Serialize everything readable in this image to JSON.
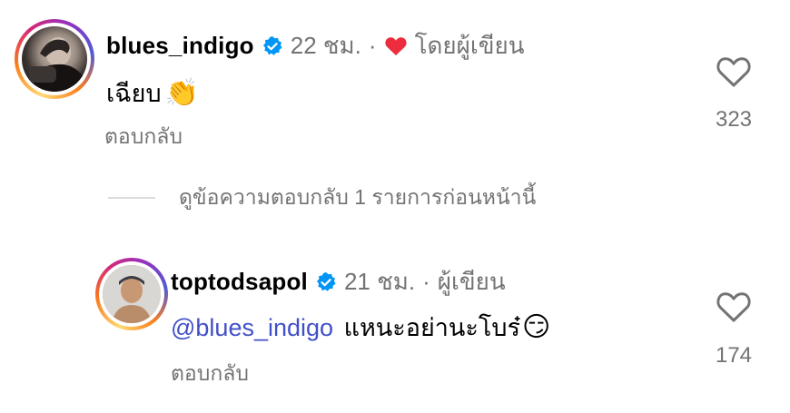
{
  "comments": [
    {
      "username": "blues_indigo",
      "time": "22 ชม.",
      "separator": "·",
      "liked_by_author": "โดยผู้เขียน",
      "text": "เฉียบ",
      "emoji": "👏",
      "reply_label": "ตอบกลับ",
      "like_count": "323",
      "icons": [
        "verified-badge-icon",
        "red-heart-icon",
        "heart-outline-icon"
      ]
    }
  ],
  "view_replies_label": "ดูข้อความตอบกลับ 1 รายการก่อนหน้านี้",
  "reply": {
    "username": "toptodsapol",
    "time": "21 ชม.",
    "separator": "·",
    "author_label": "ผู้เขียน",
    "mention": "@blues_indigo",
    "text": "แหนะอย่านะโบร๋",
    "emoji": "😏",
    "reply_label": "ตอบกลับ",
    "like_count": "174",
    "icons": [
      "verified-badge-icon",
      "heart-outline-icon"
    ]
  },
  "colors": {
    "verified_blue": "#0095f6",
    "liked_red": "#ed2d3d",
    "secondary_text": "#737373",
    "mention_blue": "#4150c8"
  }
}
